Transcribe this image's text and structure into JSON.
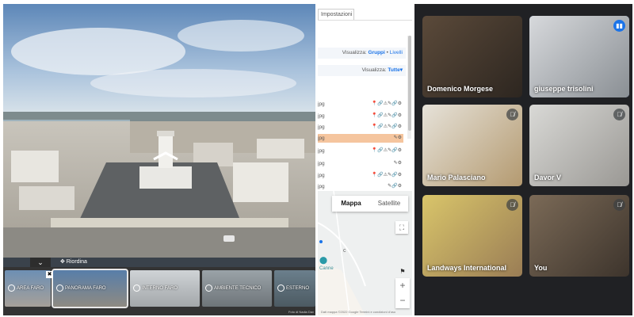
{
  "viewer": {
    "reorder_label": "✥ Riordina",
    "collapse_glyph": "⌄",
    "close_glyph": "✖",
    "credit": "Foto di Nadia Dav",
    "thumbnails": [
      {
        "label": "AREA FARO"
      },
      {
        "label": "PANORAMA FARO"
      },
      {
        "label": "INTERNO FARO"
      },
      {
        "label": "AMBIENTE TECNICO"
      },
      {
        "label": "ESTERNO"
      }
    ]
  },
  "editor": {
    "tab_label": "Impostazioni",
    "visualizza_label": "Visualizza:",
    "groups_label": "Gruppi",
    "levels_label": "Livelli",
    "separator": "•",
    "filter_label": "Visualizza:",
    "filter_value": "Tutte",
    "filter_caret": "▾",
    "files": [
      {
        "name": "jpg",
        "icons": "📍🔗⚠✎🔗⚙"
      },
      {
        "name": "jpg",
        "icons": "📍🔗⚠✎🔗⚙"
      },
      {
        "name": "jpg",
        "icons": "📍🔗⚠✎🔗⚙"
      },
      {
        "name": "jpg",
        "icons": "✎⚙",
        "highlighted": true
      },
      {
        "name": "jpg",
        "icons": "📍🔗⚠✎🔗⚙"
      },
      {
        "name": "jpg",
        "icons": "✎⚙"
      },
      {
        "name": "jpg",
        "icons": "📍🔗⚠✎🔗⚙"
      },
      {
        "name": "jpg",
        "icons": "✎🔗⚙"
      }
    ]
  },
  "map": {
    "tab_map": "Mappa",
    "tab_satellite": "Satellite",
    "zoom_in": "+",
    "zoom_out": "−",
    "fullscreen_glyph": "⛶",
    "flag_glyph": "⚑",
    "place_name": "Canne",
    "footer": "Dati mappa ©2022 Google   Termini e condizioni d'uso"
  },
  "meeting": {
    "participants": [
      {
        "name": "Domenico Morgese",
        "muted": false,
        "speaking": false
      },
      {
        "name": "giuseppe trisolini",
        "muted": false,
        "speaking": true
      },
      {
        "name": "Mario Palasciano",
        "muted": true,
        "speaking": false
      },
      {
        "name": "Davor V",
        "muted": true,
        "speaking": false
      },
      {
        "name": "Landways International",
        "muted": true,
        "speaking": false
      },
      {
        "name": "You",
        "muted": true,
        "speaking": false
      }
    ],
    "mic_off_glyph": "🎙̸",
    "speaking_glyph": "▮▮"
  }
}
